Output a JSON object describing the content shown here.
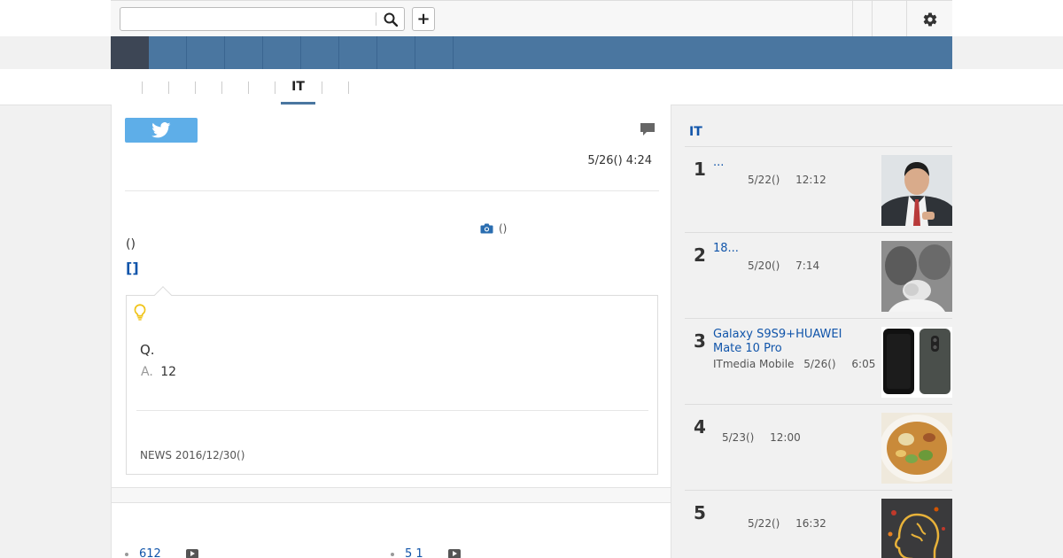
{
  "search": {
    "placeholder": "",
    "value": ""
  },
  "topbar": {
    "add_label": "+"
  },
  "subnav": {
    "active_tab": "IT"
  },
  "article": {
    "timestamp": "5/26() 4:24",
    "photo_caption": "()",
    "paren_text": "()",
    "bracket_text": "[]",
    "question": "Q.",
    "answer_label": "A.",
    "answer_value": "12",
    "source": "NEWS 2016/12/30()"
  },
  "links": [
    {
      "label": "612"
    },
    {
      "label": "5 1"
    }
  ],
  "sidebar": {
    "title": "IT",
    "items": [
      {
        "rank": "1",
        "title": "...",
        "source": "",
        "date": "5/22()",
        "time": "12:12"
      },
      {
        "rank": "2",
        "title": "18...",
        "source": "",
        "date": "5/20()",
        "time": "7:14"
      },
      {
        "rank": "3",
        "title": "Galaxy S9S9+HUAWEI Mate 10 Pro",
        "source": "ITmedia Mobile",
        "date": "5/26()",
        "time": "6:05"
      },
      {
        "rank": "4",
        "title": "",
        "source": "",
        "date": "5/23()",
        "time": "12:00"
      },
      {
        "rank": "5",
        "title": "",
        "source": "",
        "date": "5/22()",
        "time": "16:32"
      }
    ]
  },
  "colors": {
    "nav_blue": "#4a76a0",
    "home_tab": "#3d4655",
    "twitter": "#5eaee8",
    "link": "#1155aa",
    "bulb": "#f0c419"
  },
  "icons": [
    "search-icon",
    "plus-icon",
    "gear-icon",
    "twitter-icon",
    "comment-icon",
    "camera-icon",
    "lightbulb-icon",
    "video-play-icon"
  ]
}
